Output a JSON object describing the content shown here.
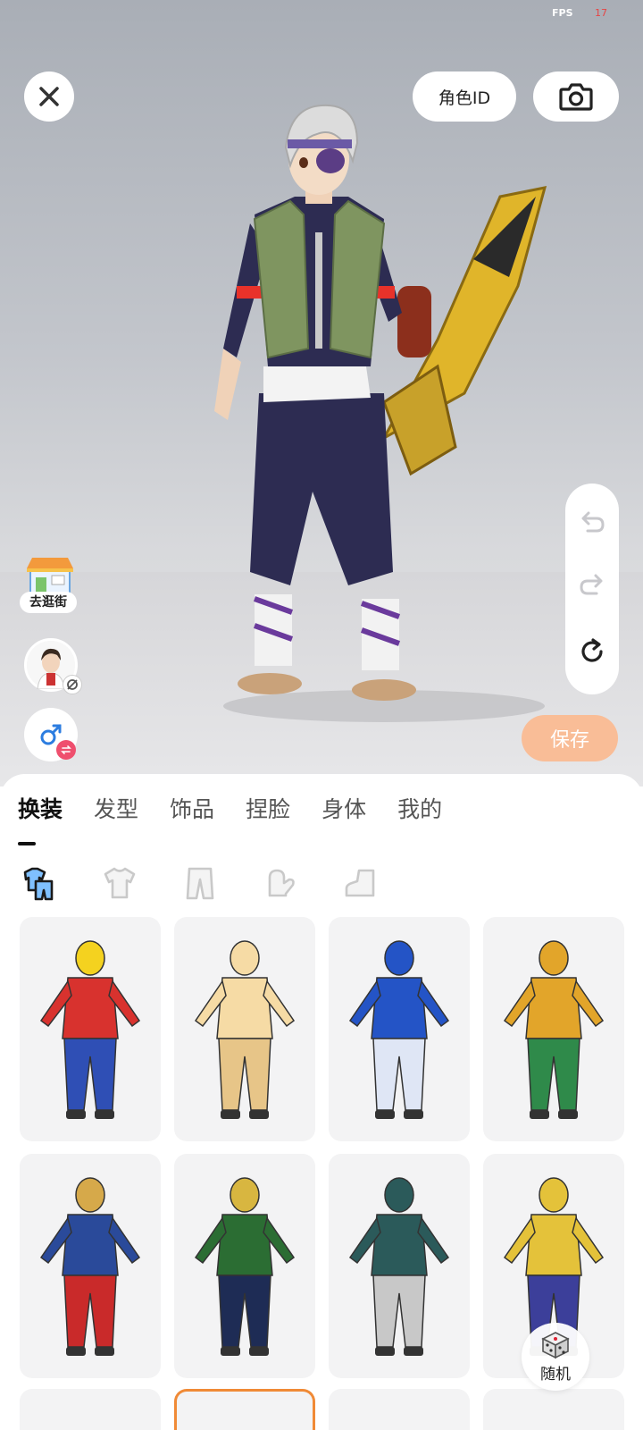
{
  "status": {
    "fps_label": "FPS",
    "fps_value": "17"
  },
  "top_bar": {
    "role_id_label": "角色ID"
  },
  "left_actions": {
    "shop_label": "去逛街"
  },
  "save_label": "保存",
  "tabs": [
    {
      "label": "换装",
      "active": true
    },
    {
      "label": "发型",
      "active": false
    },
    {
      "label": "饰品",
      "active": false
    },
    {
      "label": "捏脸",
      "active": false
    },
    {
      "label": "身体",
      "active": false
    },
    {
      "label": "我的",
      "active": false
    }
  ],
  "subcategories": [
    "outfit-set-icon",
    "top-shirt-icon",
    "pants-icon",
    "glove-icon",
    "shoe-icon"
  ],
  "outfits": [
    {
      "name": "jester-outfit",
      "colors": [
        "#d8322e",
        "#2f4fb5",
        "#f4d21f"
      ]
    },
    {
      "name": "teddy-bear-outfit",
      "colors": [
        "#f6dba5",
        "#e7c588",
        "#f6dba5"
      ]
    },
    {
      "name": "blue-hedgehog-outfit",
      "colors": [
        "#2454c6",
        "#dfe6f5",
        "#2454c6"
      ]
    },
    {
      "name": "sea-king-outfit",
      "colors": [
        "#e2a52a",
        "#2f8a4a",
        "#e2a52a"
      ]
    },
    {
      "name": "sorcerer-outfit",
      "colors": [
        "#2a4a9a",
        "#c92a2a",
        "#d6a94a"
      ]
    },
    {
      "name": "trickster-god-outfit",
      "colors": [
        "#2b6d33",
        "#1e2c55",
        "#d8b640"
      ]
    },
    {
      "name": "dark-knight-outfit",
      "colors": [
        "#2b5a5a",
        "#c8c8c8",
        "#2b5a5a"
      ]
    },
    {
      "name": "gold-armor-outfit",
      "colors": [
        "#e4c23a",
        "#3c3f9a",
        "#e4c23a"
      ]
    }
  ],
  "random_label": "随机"
}
